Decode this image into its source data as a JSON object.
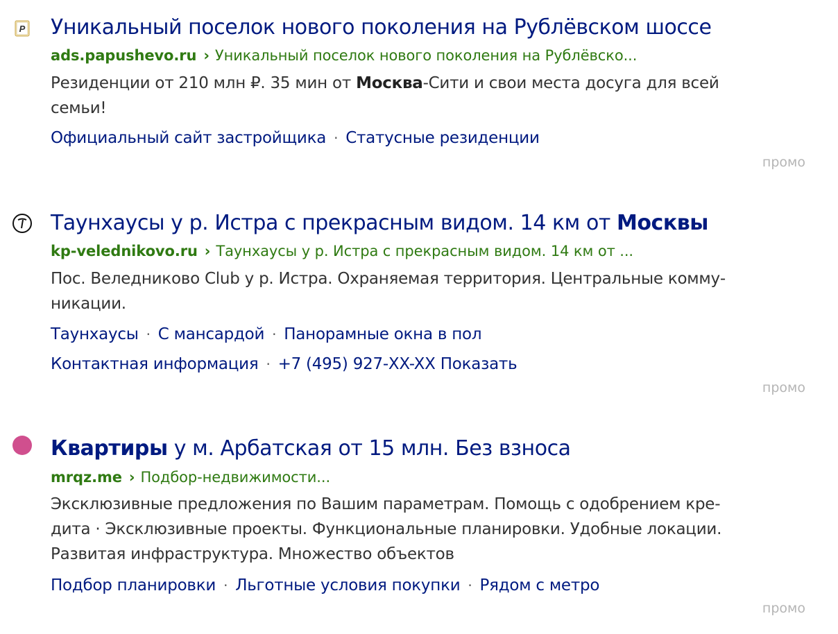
{
  "results": [
    {
      "favicon": "papushevo-favicon",
      "title": "Уникальный поселок нового поколения на Рублёвском шоссе",
      "domain": "ads.papushevo.ru",
      "separator": "›",
      "path": "Уникальный поселок нового поколения на Рублёвско...",
      "snippet_l1_a": "Резиденции от 210 млн ₽.  35 мин от ",
      "snippet_l1_b": "Москва",
      "snippet_l1_c": "-Сити и свои места досуга для всей",
      "snippet_l2": "семьи!",
      "sitelinks": [
        "Официальный сайт застройщика",
        "Статусные резиденции"
      ],
      "promo": "промо"
    },
    {
      "favicon": "veledkinovo-favicon",
      "title_a": "Таунхаусы у р. Истра с прекрасным видом. 14 км от ",
      "title_b": "Москвы",
      "domain": "kp-velednikovo.ru",
      "separator": "›",
      "path": "Таунхаусы у р. Истра с прекрасным видом. 14 км от ...",
      "snippet_l1": "Пос. Веледниково Club у р. Истра. Охраняемая территория. Центральные комму-",
      "snippet_l2": "никации.",
      "sitelinks_row1": [
        "Таунхаусы",
        "С мансардой",
        "Панорамные окна в пол"
      ],
      "sitelinks_row2": [
        "Контактная информация",
        "+7 (495) 927-XX-XX Показать"
      ],
      "promo": "промо"
    },
    {
      "favicon": "mrqz-favicon",
      "favicon_color": "#d04f8e",
      "title_a": "Квартиры",
      "title_b": " у м. Арбатская от 15 млн. Без взноса",
      "domain": "mrqz.me",
      "separator": "›",
      "path": "Подбор-недвижимости...",
      "snippet_l1": "Эксклюзивные предложения по Вашим параметрам. Помощь с одобрением кре-",
      "snippet_l2": "дита · Эксклюзивные проекты. Функциональные планировки. Удобные локации.",
      "snippet_l3": "Развитая инфраструктура. Множество объектов",
      "sitelinks": [
        "Подбор планировки",
        "Льготные условия покупки",
        "Рядом с метро"
      ],
      "promo": "промо"
    }
  ],
  "dot_separator": "·",
  "colors": {
    "title": "#001a80",
    "url": "#2f7a12",
    "snippet": "#333333",
    "promo": "#b5b5b5"
  }
}
